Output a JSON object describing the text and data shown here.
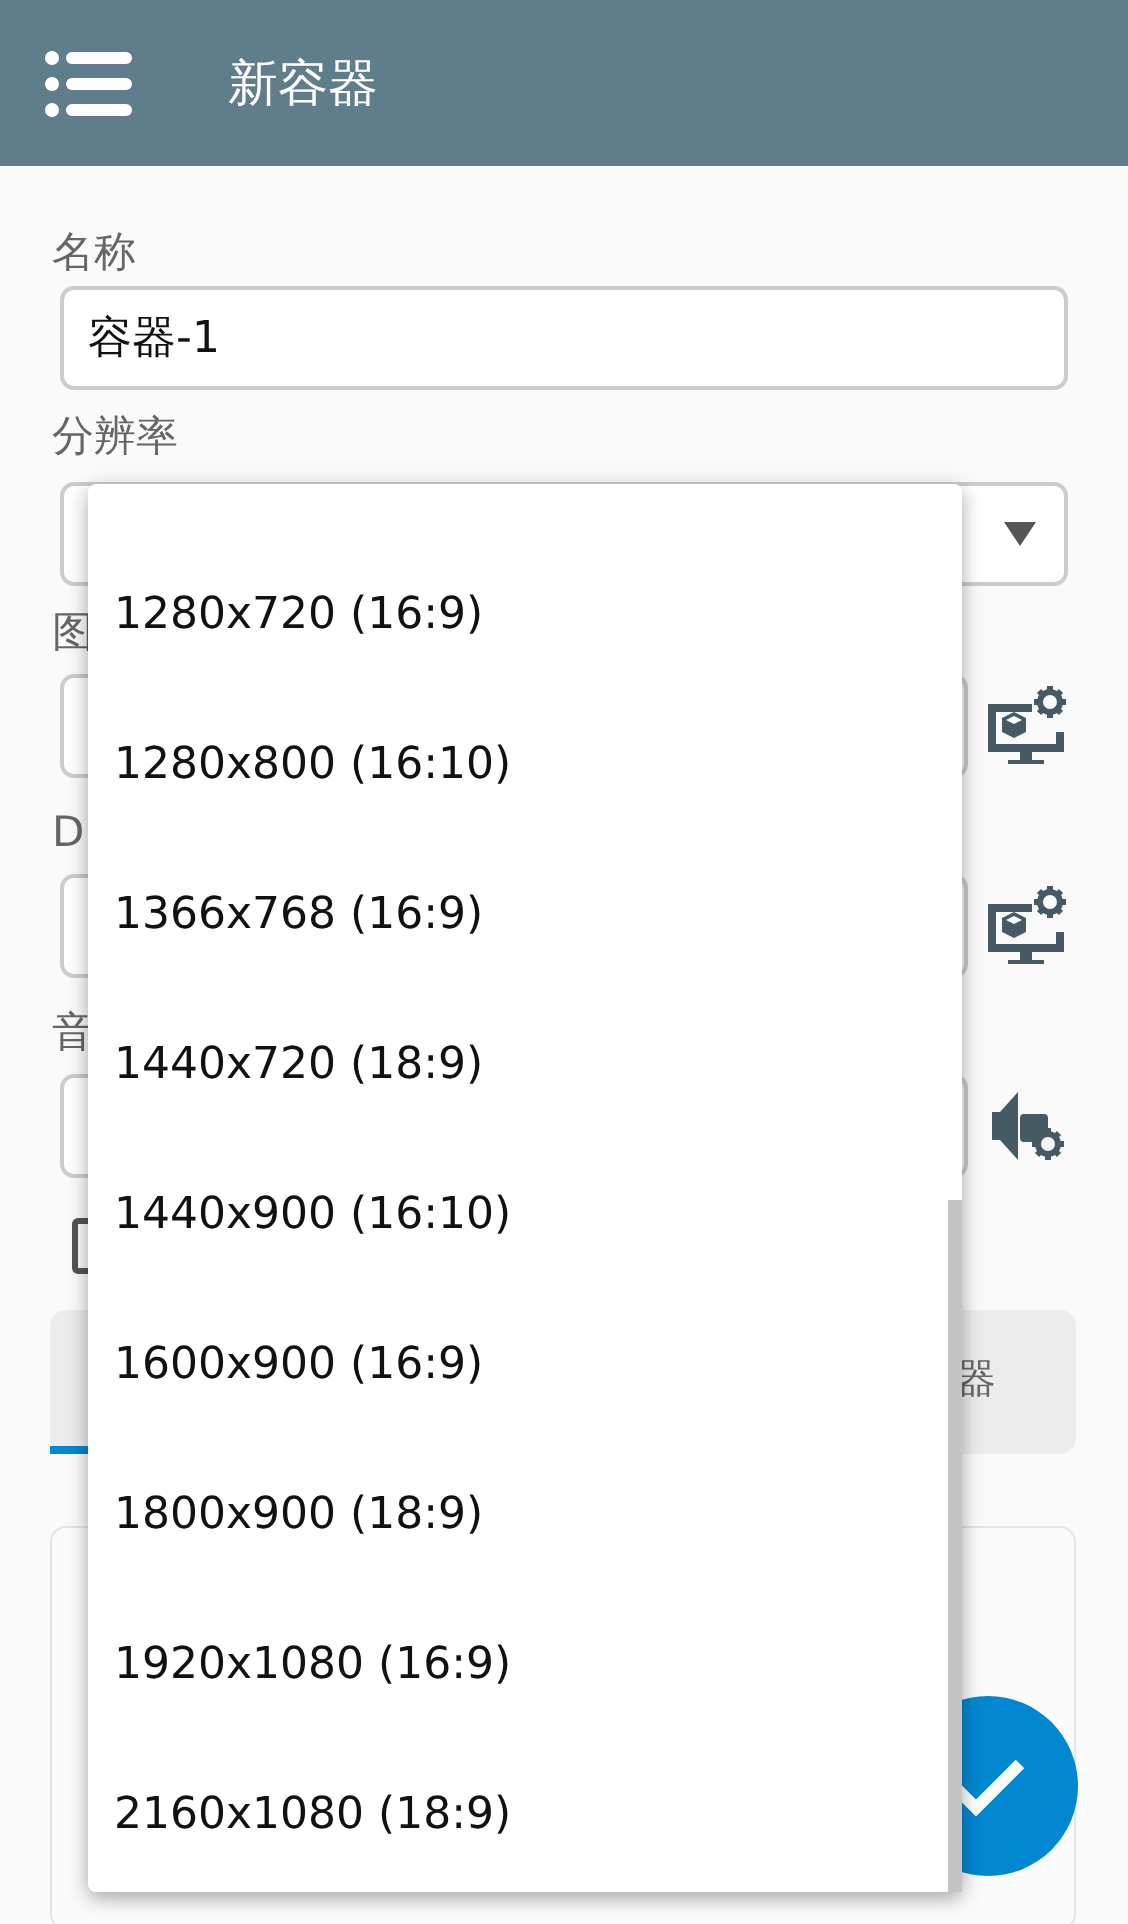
{
  "app_bar": {
    "title": "新容器"
  },
  "fields": [
    {
      "kind": "text",
      "label": "名称",
      "value": "容器-1"
    },
    {
      "kind": "select",
      "label": "分辨率"
    },
    {
      "kind": "monitor_select",
      "label": "图"
    },
    {
      "kind": "monitor_select",
      "label": "D"
    },
    {
      "kind": "speaker_select",
      "label": "音"
    }
  ],
  "checkbox": {
    "checked": false
  },
  "tabs": [
    {
      "selected": true
    },
    {
      "label": "器",
      "selected": false
    }
  ],
  "dropdown": {
    "options": [
      "1280x720 (16:9)",
      "1280x800 (16:10)",
      "1366x768 (16:9)",
      "1440x720 (18:9)",
      "1440x900 (16:10)",
      "1600x900 (16:9)",
      "1800x900 (18:9)",
      "1920x1080 (16:9)",
      "2160x1080 (18:9)"
    ]
  }
}
